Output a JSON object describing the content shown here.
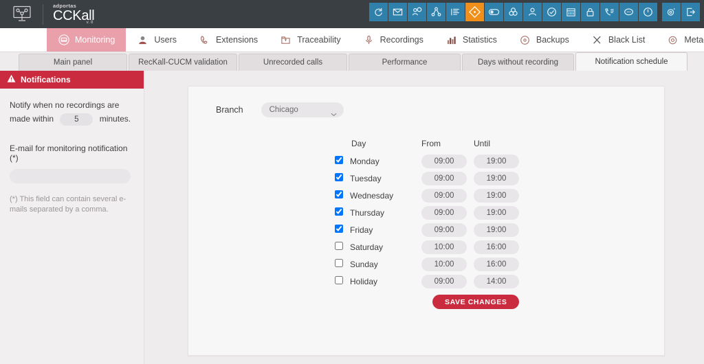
{
  "header": {
    "brand_sub": "adportas",
    "brand_main": "CCKall",
    "brand_version": "v. 8",
    "logo_icon": "network-topology-screen-icon",
    "accent_color": "#f0901a",
    "bar_color": "#3a3f44",
    "icon_button_color": "#2f81ab",
    "icons": [
      {
        "name": "refresh-icon",
        "glyph": "refresh"
      },
      {
        "name": "mail-icon",
        "glyph": "envelope"
      },
      {
        "name": "user-search-icon",
        "glyph": "user-search"
      },
      {
        "name": "share-nodes-icon",
        "glyph": "share"
      },
      {
        "name": "list-icon",
        "glyph": "list"
      },
      {
        "name": "diamond-icon",
        "glyph": "diamond",
        "active": true
      },
      {
        "name": "toggle-icon",
        "glyph": "toggle"
      },
      {
        "name": "venn-icon",
        "glyph": "venn"
      },
      {
        "name": "person-icon",
        "glyph": "person"
      },
      {
        "name": "check-circle-icon",
        "glyph": "check-circle"
      },
      {
        "name": "calendar-icon",
        "glyph": "calendar"
      },
      {
        "name": "lock-icon",
        "glyph": "lock"
      },
      {
        "name": "phone-list-icon",
        "glyph": "phone-list"
      },
      {
        "name": "chat-icon",
        "glyph": "chat"
      },
      {
        "name": "power-icon",
        "glyph": "power"
      },
      {
        "name": "settings-icon",
        "glyph": "gear"
      },
      {
        "name": "logout-icon",
        "glyph": "logout"
      }
    ]
  },
  "mainnav": {
    "active_color": "#e9a0ab",
    "items": [
      {
        "label": "Monitoring",
        "icon": "monitor-icon",
        "active": true
      },
      {
        "label": "Users",
        "icon": "user-avatar-icon",
        "active": false
      },
      {
        "label": "Extensions",
        "icon": "phone-icon",
        "active": false
      },
      {
        "label": "Traceability",
        "icon": "folder-out-icon",
        "active": false
      },
      {
        "label": "Recordings",
        "icon": "microphone-icon",
        "active": false
      },
      {
        "label": "Statistics",
        "icon": "bar-chart-icon",
        "active": false
      },
      {
        "label": "Backups",
        "icon": "disc-icon",
        "active": false
      },
      {
        "label": "Black List",
        "icon": "scissors-icon",
        "active": false
      },
      {
        "label": "Metadata",
        "icon": "gear-outline-icon",
        "active": false
      }
    ]
  },
  "tabs": [
    {
      "label": "Main panel",
      "active": false
    },
    {
      "label": "RecKall-CUCM validation",
      "active": false
    },
    {
      "label": "Unrecorded calls",
      "active": false
    },
    {
      "label": "Performance",
      "active": false
    },
    {
      "label": "Days without recording",
      "active": false
    },
    {
      "label": "Notification schedule",
      "active": true
    }
  ],
  "sidebar": {
    "title": "Notifications",
    "title_icon": "warning-triangle-icon",
    "title_bg": "#cb2b3f",
    "notify_text_before": "Notify when no recordings are made within",
    "notify_minutes_value": "5",
    "notify_text_after": "minutes.",
    "email_label": "E-mail for monitoring notification (*)",
    "email_value": "",
    "email_placeholder": "",
    "footnote": "(*) This field can contain several e-mails separated by a comma."
  },
  "main": {
    "branch_label": "Branch",
    "branch_selected": "Chicago",
    "branch_options": [
      "Chicago"
    ],
    "columns": {
      "day": "Day",
      "from": "From",
      "until": "Until"
    },
    "rows": [
      {
        "day": "Monday",
        "checked": true,
        "from": "09:00",
        "until": "19:00"
      },
      {
        "day": "Tuesday",
        "checked": true,
        "from": "09:00",
        "until": "19:00"
      },
      {
        "day": "Wednesday",
        "checked": true,
        "from": "09:00",
        "until": "19:00"
      },
      {
        "day": "Thursday",
        "checked": true,
        "from": "09:00",
        "until": "19:00"
      },
      {
        "day": "Friday",
        "checked": true,
        "from": "09:00",
        "until": "19:00"
      },
      {
        "day": "Saturday",
        "checked": false,
        "from": "10:00",
        "until": "16:00"
      },
      {
        "day": "Sunday",
        "checked": false,
        "from": "10:00",
        "until": "16:00"
      },
      {
        "day": "Holiday",
        "checked": false,
        "from": "09:00",
        "until": "14:00"
      }
    ],
    "save_label": "SAVE CHANGES",
    "save_color": "#cb2b3f"
  }
}
